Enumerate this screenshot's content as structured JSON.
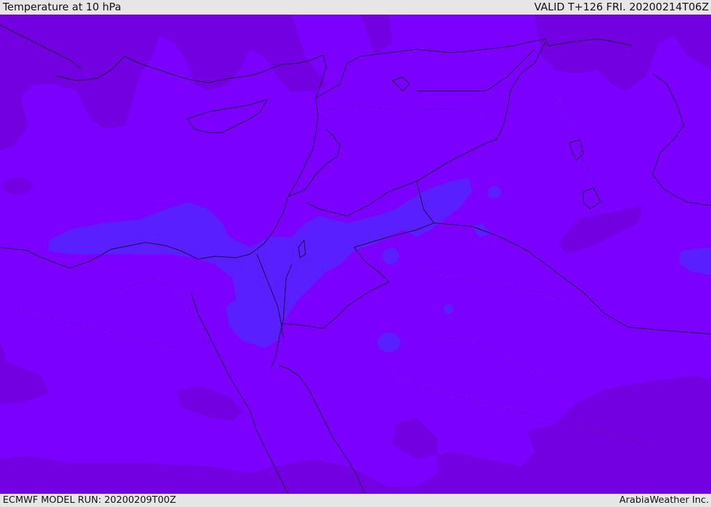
{
  "header": {
    "title": "Temperature at 10 hPa",
    "valid_time": "VALID T+126 FRI. 20200214T06Z"
  },
  "footer": {
    "model_run": "ECMWF MODEL RUN: 20200209T00Z",
    "credit": "ArabiaWeather Inc."
  },
  "map": {
    "field": "temperature",
    "level": "10 hPa",
    "colors": {
      "base": "#7b00ff",
      "warm_band": "#7300e0",
      "cold_band": "#5a1fff",
      "coast": "#1a0a33"
    }
  }
}
